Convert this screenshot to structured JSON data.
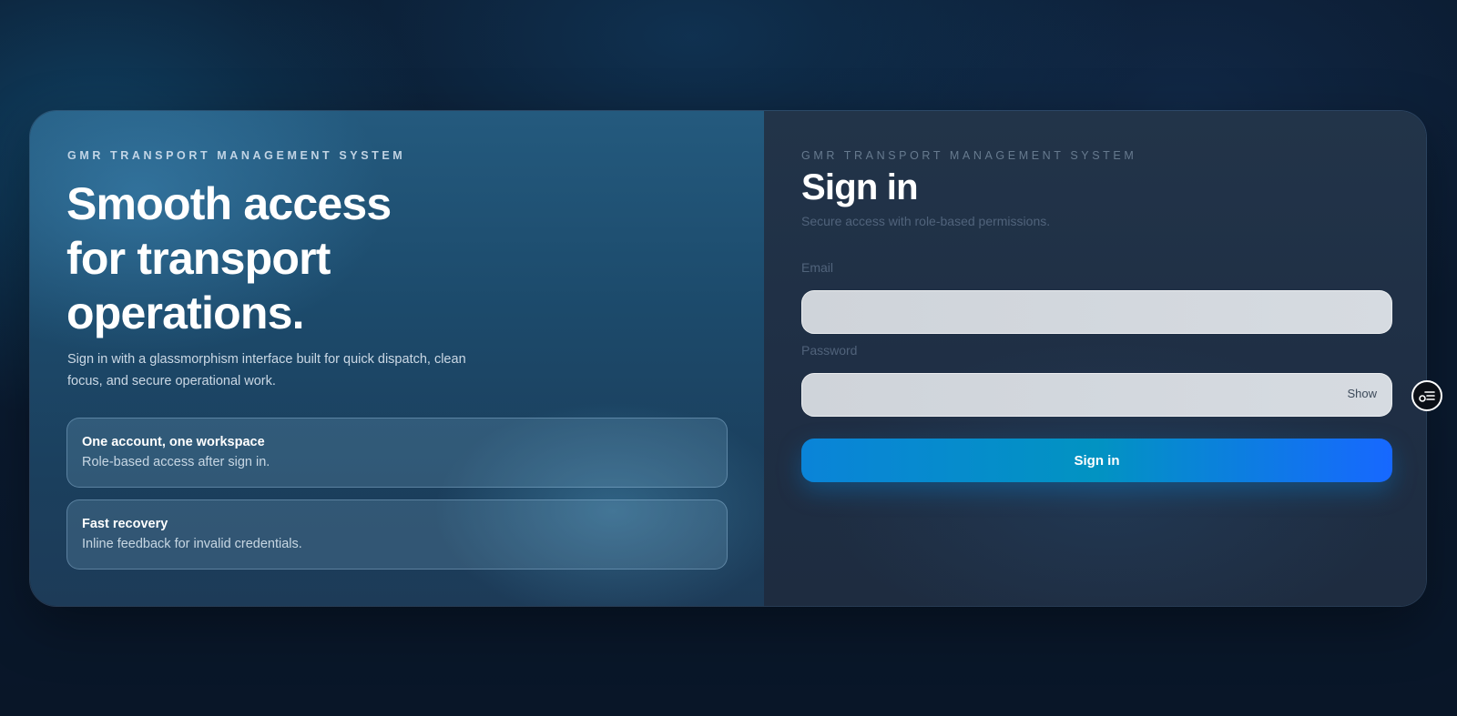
{
  "brand": {
    "eyebrow": "GMR TRANSPORT MANAGEMENT SYSTEM"
  },
  "hero": {
    "headline_line1": "Smooth access",
    "headline_line2": "for transport",
    "headline_line3": "operations.",
    "lead": "Sign in with a glassmorphism interface built for quick dispatch, clean focus, and secure operational work.",
    "features": [
      {
        "title": "One account, one workspace",
        "desc": "Role-based access after sign in."
      },
      {
        "title": "Fast recovery",
        "desc": "Inline feedback for invalid credentials."
      }
    ]
  },
  "form": {
    "eyebrow": "GMR TRANSPORT MANAGEMENT SYSTEM",
    "title": "Sign in",
    "subtitle": "Secure access with role-based permissions.",
    "email_label": "Email",
    "email_value": "",
    "password_label": "Password",
    "password_value": "",
    "show_label": "Show",
    "submit_label": "Sign in"
  },
  "floating": {
    "icon": "settings-list-icon"
  },
  "colors": {
    "accent_start": "#0a84d8",
    "accent_end": "#1768ff",
    "background": "#0a1a2f"
  }
}
